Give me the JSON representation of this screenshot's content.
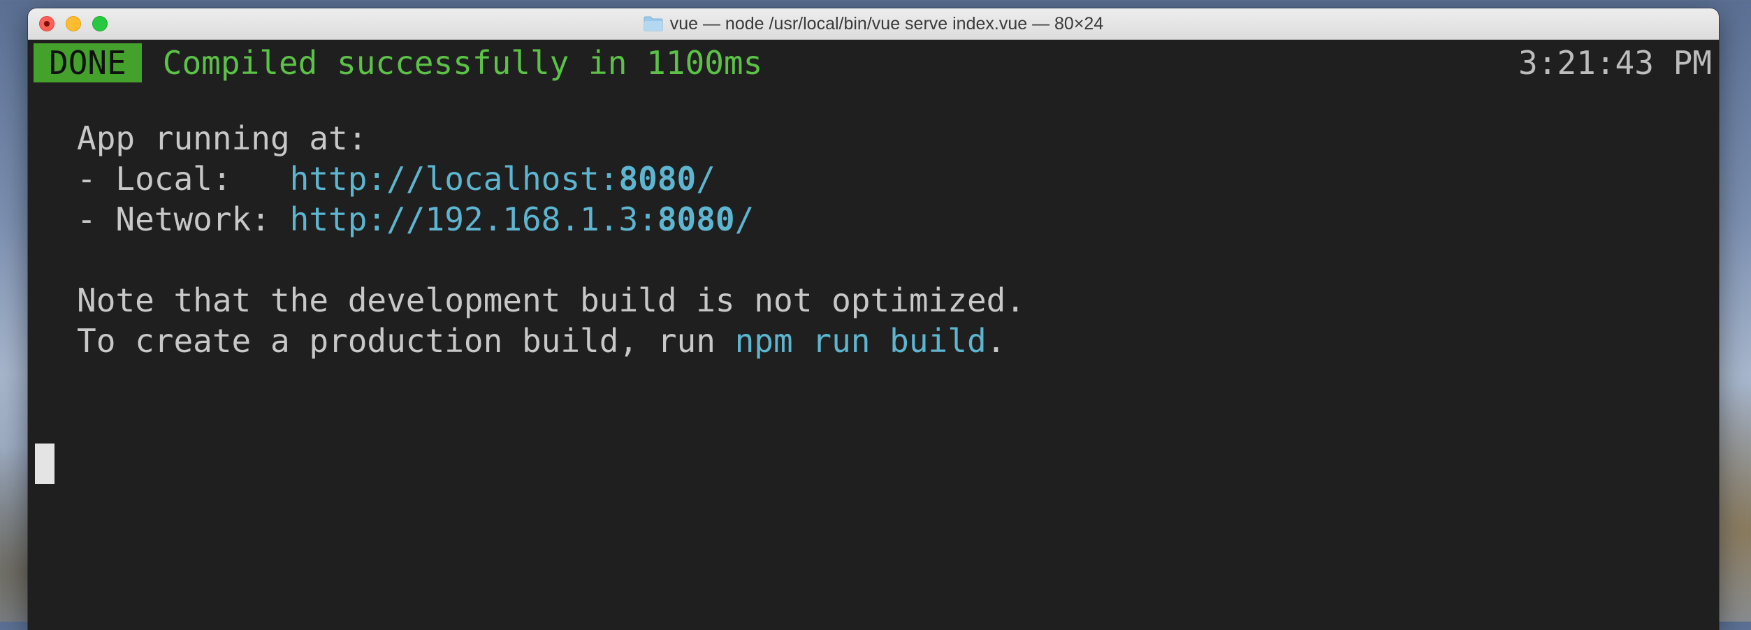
{
  "window": {
    "title": "vue — node /usr/local/bin/vue serve index.vue — 80×24"
  },
  "terminal": {
    "status_badge": "DONE",
    "status_message": "Compiled successfully in 1100ms",
    "timestamp": "3:21:43 PM",
    "app_running_label": "App running at:",
    "local_label": "- Local:   ",
    "local_url_prefix": "http://localhost:",
    "local_url_port": "8080",
    "local_url_suffix": "/",
    "network_label": "- Network: ",
    "network_url_prefix": "http://192.168.1.3:",
    "network_url_port": "8080",
    "network_url_suffix": "/",
    "note_line": "Note that the development build is not optimized.",
    "prod_line_prefix": "To create a production build, run ",
    "prod_command": "npm run build",
    "prod_line_suffix": "."
  },
  "colors": {
    "badge_bg": "#44a12c",
    "success_text": "#5cc247",
    "link_text": "#5eb5cf",
    "terminal_bg": "#1f1f1f",
    "terminal_text": "#c8c8c8"
  },
  "icons": {
    "title_folder": "folder-icon",
    "close": "close-icon",
    "minimize": "minimize-icon",
    "maximize": "maximize-icon"
  }
}
